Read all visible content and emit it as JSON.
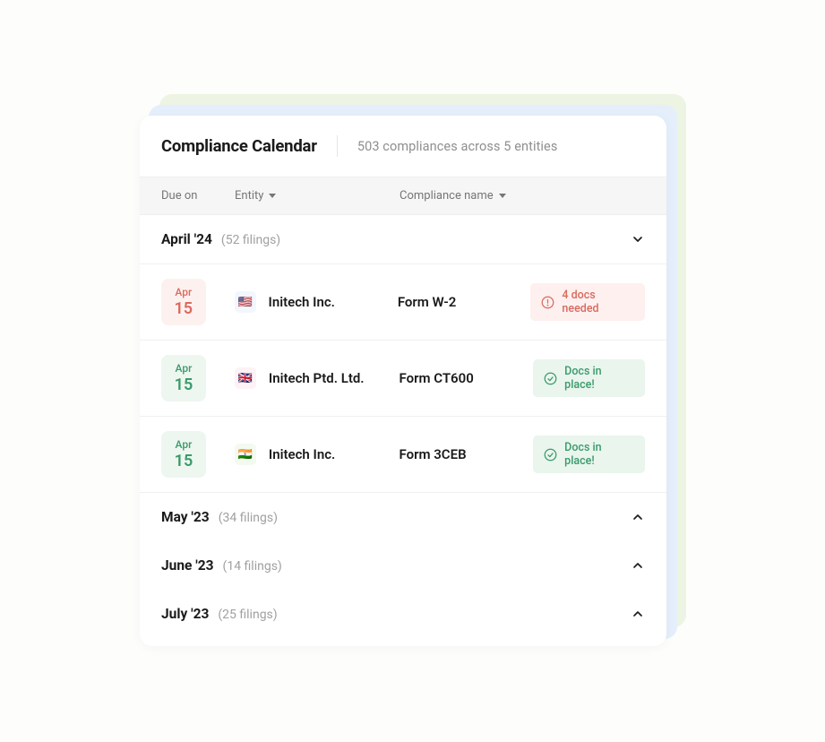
{
  "header": {
    "title": "Compliance Calendar",
    "subtitle": "503 compliances across 5 entities"
  },
  "columns": {
    "due": "Due on",
    "entity": "Entity",
    "compliance": "Compliance name"
  },
  "months": [
    {
      "id": "apr24",
      "label": "April '24",
      "count": "(52 filings)",
      "expanded": true,
      "items": [
        {
          "date_month": "Apr",
          "date_day": "15",
          "date_style": "red",
          "flag_region": "us",
          "flag_emoji": "🇺🇸",
          "entity": "Initech Inc.",
          "form": "Form W-2",
          "status_kind": "warn",
          "status_text": "4 docs needed"
        },
        {
          "date_month": "Apr",
          "date_day": "15",
          "date_style": "green",
          "flag_region": "gb",
          "flag_emoji": "🇬🇧",
          "entity": "Initech Ptd. Ltd.",
          "form": "Form CT600",
          "status_kind": "ok",
          "status_text": "Docs in place!"
        },
        {
          "date_month": "Apr",
          "date_day": "15",
          "date_style": "green",
          "flag_region": "in",
          "flag_emoji": "🇮🇳",
          "entity": "Initech Inc.",
          "form": "Form 3CEB",
          "status_kind": "ok",
          "status_text": "Docs in place!"
        }
      ]
    },
    {
      "id": "may23",
      "label": "May '23",
      "count": "(34 filings)",
      "expanded": false,
      "items": []
    },
    {
      "id": "jun23",
      "label": "June '23",
      "count": "(14 filings)",
      "expanded": false,
      "items": []
    },
    {
      "id": "jul23",
      "label": "July '23",
      "count": "(25 filings)",
      "expanded": false,
      "items": []
    }
  ]
}
